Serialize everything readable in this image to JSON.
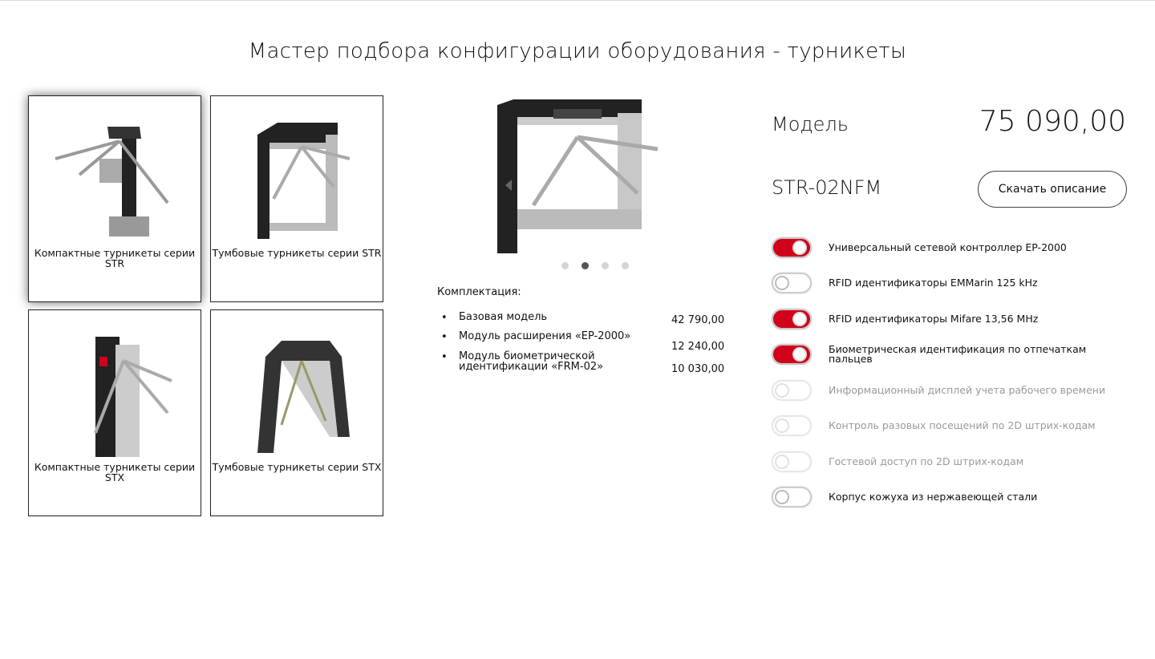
{
  "title": "Мастер подбора конфигурации оборудования - турникеты",
  "categories": [
    {
      "label": "Компактные турникеты серии STR",
      "selected": true
    },
    {
      "label": "Тумбовые турникеты серии STR",
      "selected": false
    },
    {
      "label": "Компактные турникеты серии STX",
      "selected": false
    },
    {
      "label": "Тумбовые турникеты серии STX",
      "selected": false
    }
  ],
  "carousel": {
    "count": 4,
    "active": 2
  },
  "kit": {
    "title": "Комплектация:",
    "items": [
      {
        "name": "Базовая модель",
        "price": "42 790,00"
      },
      {
        "name": "Модуль расширения «EP-2000»",
        "price": "12 240,00"
      },
      {
        "name": "Модуль биометрической идентификации «FRM-02»",
        "price": "10 030,00"
      }
    ]
  },
  "model": {
    "label": "Модель",
    "price": "75 090,00",
    "code": "STR-02NFM",
    "download_label": "Скачать описание"
  },
  "options": [
    {
      "label": "Универсальный сетевой контроллер EP-2000",
      "on": true,
      "disabled": false
    },
    {
      "label": "RFID идентификаторы EMMarin 125 kHz",
      "on": false,
      "disabled": false
    },
    {
      "label": "RFID идентификаторы Mifare 13,56 MHz",
      "on": true,
      "disabled": false
    },
    {
      "label": "Биометрическая идентификация по отпечаткам пальцев",
      "on": true,
      "disabled": false
    },
    {
      "label": "Информационный дисплей учета рабочего времени",
      "on": false,
      "disabled": true
    },
    {
      "label": "Контроль разовых посещений по 2D штрих-кодам",
      "on": false,
      "disabled": true
    },
    {
      "label": "Гостевой доступ по 2D штрих-кодам",
      "on": false,
      "disabled": true
    },
    {
      "label": "Корпус кожуха из нержавеющей стали",
      "on": false,
      "disabled": false
    }
  ],
  "colors": {
    "accent": "#d0021b"
  }
}
